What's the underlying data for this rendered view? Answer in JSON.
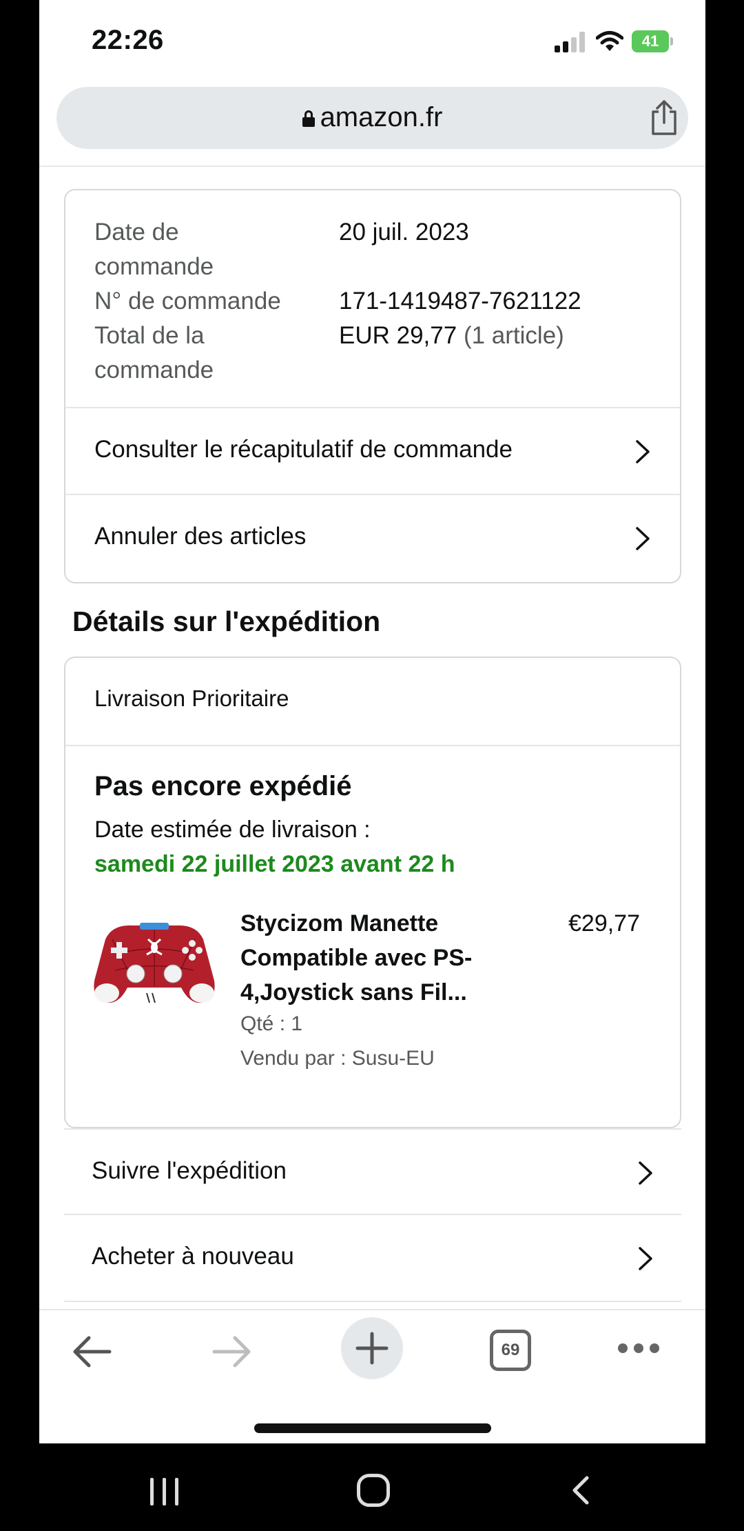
{
  "status_bar": {
    "time": "22:26",
    "battery": "41"
  },
  "url_bar": {
    "domain": "amazon.fr",
    "lock_icon": "lock-icon",
    "share_icon": "share-icon"
  },
  "order_info": {
    "date_label": "Date de commande",
    "date_value": "20 juil. 2023",
    "number_label": "N° de commande",
    "number_value": "171-1419487-7621122",
    "total_label": "Total de la commande",
    "total_value": "EUR 29,77",
    "total_items": "(1 article)"
  },
  "order_links": {
    "summary": "Consulter le récapitulatif de commande",
    "cancel": "Annuler des articles"
  },
  "shipment": {
    "section_title": "Détails sur l'expédition",
    "type": "Livraison Prioritaire",
    "status": "Pas encore expédié",
    "estimate_label": "Date estimée de livraison :",
    "estimate_date": "samedi 22 juillet 2023 avant 22 h",
    "estimate_color": "#1d8a1d"
  },
  "product": {
    "title": "Stycizom Manette Compatible avec PS-4,Joystick sans Fil...",
    "price": "€29,77",
    "qty": "Qté : 1",
    "seller": "Vendu par : Susu-EU",
    "image_icon": "red-controller-image"
  },
  "actions": {
    "track": "Suivre l'expédition",
    "rebuy": "Acheter à nouveau"
  },
  "toolbar": {
    "tab_count": "69",
    "icons": [
      "back-arrow-icon",
      "forward-arrow-icon",
      "plus-icon",
      "tabs-icon",
      "more-icon"
    ]
  }
}
